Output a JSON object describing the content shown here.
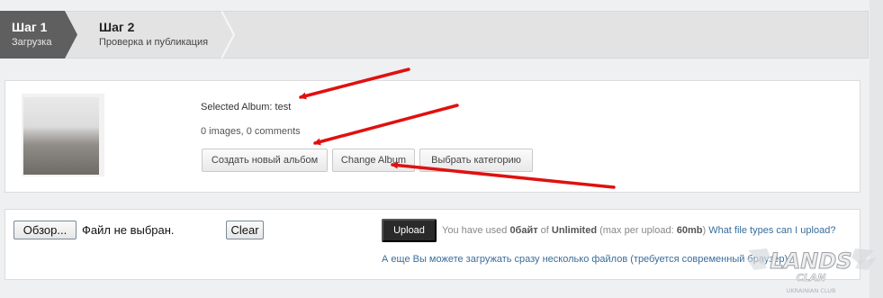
{
  "steps": [
    {
      "title": "Шаг 1",
      "subtitle": "Загрузка",
      "active": true
    },
    {
      "title": "Шаг 2",
      "subtitle": "Проверка и публикация",
      "active": false
    }
  ],
  "album": {
    "selected_label": "Selected Album: test",
    "stats": "0 images, 0 comments",
    "buttons": {
      "create": "Создать новый альбом",
      "change": "Change Album",
      "category": "Выбрать категорию"
    }
  },
  "upload": {
    "browse_label": "Обзор...",
    "file_status": "Файл не выбран.",
    "clear_label": "Clear",
    "upload_label": "Upload",
    "usage_prefix": "You have used ",
    "usage_used": "0байт",
    "usage_of": " of ",
    "usage_limit": "Unlimited",
    "usage_max_prefix": " (max per upload: ",
    "usage_max_value": "60mb",
    "usage_max_suffix": ") ",
    "file_types_link": "What file types can I upload?",
    "multi_upload_link": "А еще Вы можете загружать сразу несколько файлов (требуется современный браузер)"
  },
  "watermark": {
    "name": "LANDS",
    "line2": "CLAN",
    "line3": "UKRAINIAN CLUB"
  },
  "colors": {
    "active_step": "#5f5f5f",
    "upload_button": "#2a2a2a",
    "link": "#3a6d9a",
    "annotation_arrow": "#e01010"
  }
}
